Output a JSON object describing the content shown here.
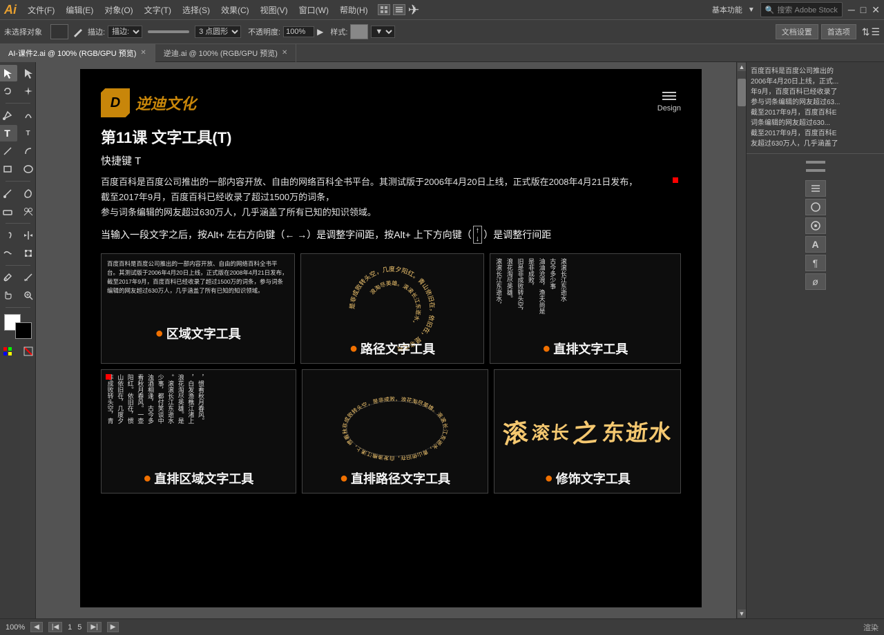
{
  "app": {
    "logo": "Ai",
    "logo_color": "#e8a030"
  },
  "menu": {
    "items": [
      "文件(F)",
      "编辑(E)",
      "对象(O)",
      "文字(T)",
      "选择(S)",
      "效果(C)",
      "视图(V)",
      "窗口(W)",
      "帮助(H)"
    ]
  },
  "toolbar": {
    "no_selection": "未选择对象",
    "blend_label": "描边:",
    "point_shape": "3 点圆形",
    "opacity_label": "不透明度:",
    "opacity_value": "100%",
    "style_label": "样式:",
    "doc_settings": "文档设置",
    "preferences": "首选项"
  },
  "tabs": [
    {
      "label": "AI-课件2.ai @ 100% (RGB/GPU 预览)",
      "active": true
    },
    {
      "label": "逆迪.ai @ 100% (RGB/GPU 预览)",
      "active": false
    }
  ],
  "canvas": {
    "logo_text": "逆迪文化",
    "design_label": "Design",
    "lesson_title": "第11课   文字工具(T)",
    "shortcut": "快捷键 T",
    "intro_text": "百度百科是百度公司推出的一部内容开放、自由的网络百科全书平台。其测试版于2006年4月20日上线，正式版在2008年4月21日发布，\n截至2017年9月，百度百科已经收录了超过1500万的词条，\n参与词条编辑的网友超过630万人，几乎涵盖了所有已知的知识领域。",
    "alt_instruction": "当输入一段文字之后，按Alt+ 左右方向键（← →）是调整字间距，按Alt+ 上下方向键（   ）是调整行间距",
    "tool1_label": "区域文字工具",
    "tool2_label": "路径文字工具",
    "tool3_label": "直排文字工具",
    "tool4_label": "直排区域文字工具",
    "tool5_label": "直排路径文字工具",
    "tool6_label": "修饰文字工具",
    "example_text": "百度百科是百度公司推出的一部内容开放、自由的网络百科全书平台。其测试版于2006年4月20日上线，正式版在2008年4月21日发布，截至2017年9月，百度百科已经收录了超过1500万的词条，参与词条编辑的网友超过630万人，几乎涵盖了所有已知的知识领域。",
    "poem_text": "非成败转头空，青山依旧在，几度夕阳红。在，惯看秋月春风。一壶浊酒喜相逢，古今多少事，都付笑谈中。滚滚长江东逝水，浪花淘尽英雄。是非成败转头空，青山依旧在，几度夕阳红。日发，都付笑谈上，惯看秋月",
    "right_panel_text": "百度百科是百度公司推出的\n2006年4月20日上线，正式...\n年9月，百度百科已经收录了\n参与词条编辑的网友超过63...\n截至2017年9月，百度百科E\n词条编辑的网友超过630...\n截至2017年9月，百度百科E\n友超过630万人，几乎涵盖了"
  },
  "status_bar": {
    "zoom": "100%",
    "page": "1",
    "page_of": "5"
  },
  "icons": {
    "arrow": "↖",
    "direct_select": "↗",
    "lasso": "⊂",
    "pen": "✒",
    "add_anchor": "+✒",
    "delete_anchor": "-✒",
    "type": "T",
    "line": "/",
    "rect": "□",
    "ellipse": "○",
    "brush": "~",
    "pencil": "✎",
    "rotate": "↺",
    "reflect": "↔",
    "scale": "⇲",
    "shear": "⫠",
    "width": "←→",
    "free_transform": "⬚",
    "shape_builder": "⊕",
    "gradient": "■",
    "mesh": "⊞",
    "eye_dropper": "⚗",
    "blend": "∞",
    "symbol": "⊛",
    "column_graph": "▦",
    "slice": "⊘",
    "hand": "✋",
    "zoom": "⊕",
    "foreground": "#ffffff",
    "background": "#000000"
  }
}
